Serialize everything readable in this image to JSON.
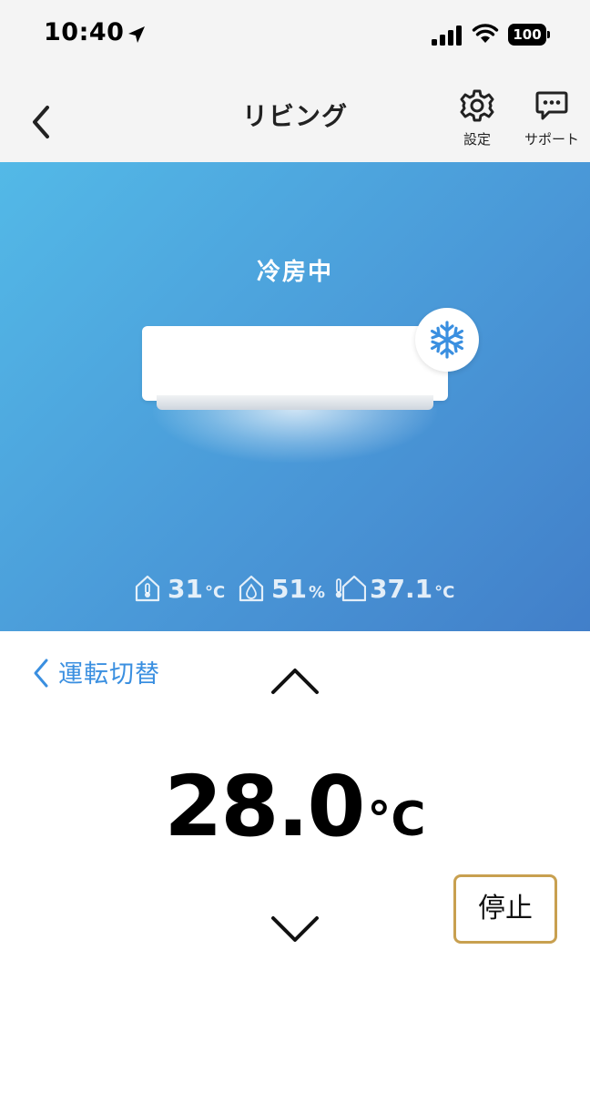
{
  "status_bar": {
    "time": "10:40",
    "battery_level": "100",
    "icons": [
      "location-arrow-icon",
      "cellular-signal-icon",
      "wifi-icon",
      "battery-icon"
    ]
  },
  "nav": {
    "title": "リビング",
    "back_icon": "chevron-left-icon",
    "settings": {
      "label": "設定",
      "icon": "gear-icon"
    },
    "support": {
      "label": "サポート",
      "icon": "chat-bubble-icon"
    }
  },
  "hero": {
    "mode_status": "冷房中",
    "mode_icon": "snowflake-icon",
    "background_colors": [
      "#53b9e7",
      "#427fc9"
    ],
    "readings": [
      {
        "icon": "indoor-temperature-icon",
        "value": "31",
        "unit": "°C"
      },
      {
        "icon": "indoor-humidity-icon",
        "value": "51",
        "unit": "%"
      },
      {
        "icon": "outdoor-temperature-icon",
        "value": "37.1",
        "unit": "°C"
      }
    ]
  },
  "controls": {
    "mode_switch_label": "運転切替",
    "mode_switch_icon": "chevron-left-icon",
    "accent_color": "#3a8fe0",
    "temperature": {
      "value": "28.0",
      "unit": "°C"
    },
    "up_icon": "chevron-up-icon",
    "down_icon": "chevron-down-icon",
    "stop_label": "停止",
    "stop_border_color": "#c8a050"
  }
}
